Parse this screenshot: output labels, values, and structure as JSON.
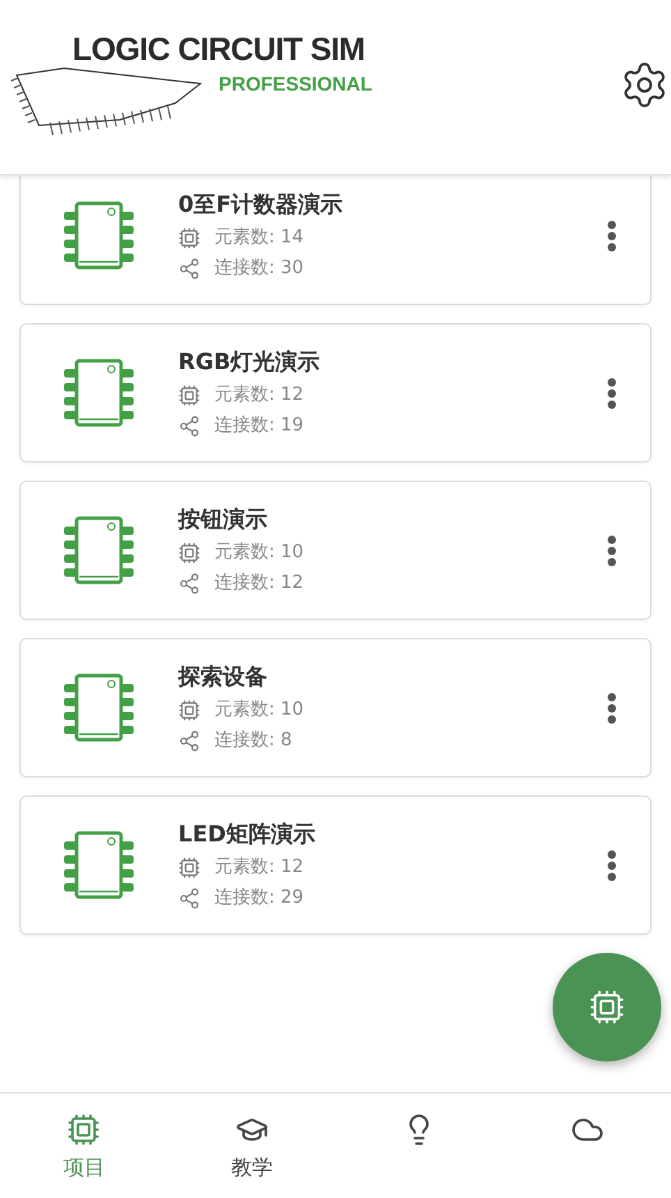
{
  "header": {
    "title": "LOGIC CIRCUIT SIM",
    "subtitle": "PROFESSIONAL"
  },
  "projects": [
    {
      "name": "0至F计数器演示",
      "elements": "元素数: 14",
      "connections": "连接数: 30"
    },
    {
      "name": "RGB灯光演示",
      "elements": "元素数: 12",
      "connections": "连接数: 19"
    },
    {
      "name": "按钮演示",
      "elements": "元素数: 10",
      "connections": "连接数: 12"
    },
    {
      "name": "探索设备",
      "elements": "元素数: 10",
      "connections": "连接数: 8"
    },
    {
      "name": "LED矩阵演示",
      "elements": "元素数: 12",
      "connections": "连接数: 29"
    }
  ],
  "bottom_nav": [
    {
      "kind": "chip",
      "label": "项目",
      "selected": true
    },
    {
      "kind": "school",
      "label": "教学",
      "selected": false
    },
    {
      "kind": "bulb",
      "selected": false
    },
    {
      "kind": "cloud",
      "selected": false
    }
  ]
}
